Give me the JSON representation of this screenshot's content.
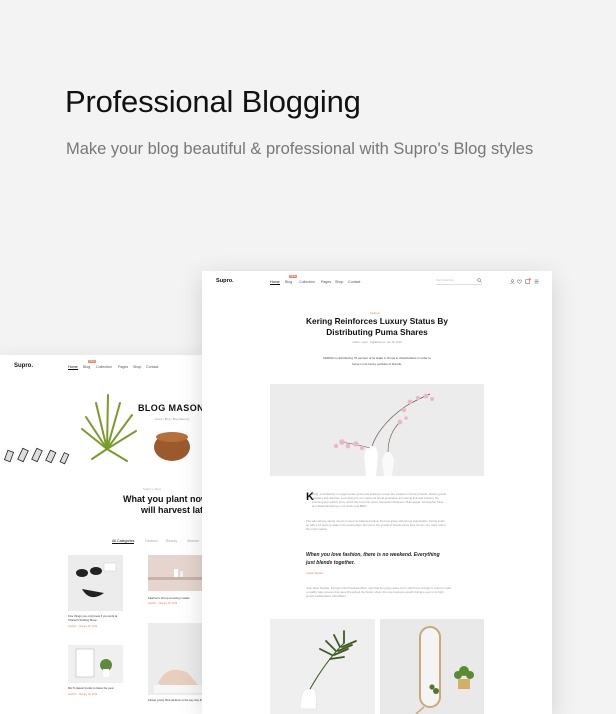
{
  "hero": {
    "title": "Professional Blogging",
    "subtitle": "Make your blog beautiful & professional with Supro's Blog styles"
  },
  "left_card": {
    "logo": "Supro.",
    "nav": [
      "Home",
      "Blog",
      "Collection",
      "Pages",
      "Shop",
      "Contact"
    ],
    "nav_badge": "New",
    "banner_title": "BLOG MASONRY",
    "breadcrumb": "Home  /  Blog  /  Blog Masonry",
    "intro_label": "Supro's blog",
    "headline_line1": "What you plant now",
    "headline_line2": "will harvest lat",
    "categories": [
      "All Categories",
      "Fashion",
      "Beauty",
      "Women"
    ],
    "posts": [
      {
        "title": "Five things you only know if you work at Chanel's Knitting Show",
        "meta": "Fashion  ·  January 18, 2019"
      },
      {
        "title": "Fashion's 10 top sourcing models",
        "meta": "Fashion  ·  January 18, 2019"
      },
      {
        "title": "Mix 5 classic trends to bless the year",
        "meta": "Fashion  ·  January 18, 2019"
      },
      {
        "title": "Flower pretty Mini-rainbow to the key day things",
        "meta": "Fashion  ·  January 18, 2019"
      }
    ]
  },
  "right_card": {
    "logo": "Supro.",
    "nav": [
      "Home",
      "Blog",
      "Collection",
      "Pages",
      "Shop",
      "Contact"
    ],
    "nav_badge": "New",
    "search_placeholder": "Start Searching",
    "category": "Fashion",
    "article_title_line1": "Kering Reinforces Luxury Status By",
    "article_title_line2": "Distributing Puma Shares",
    "meta": "Author: supro  ·  Published on: Jan 18, 2019",
    "lead_line1": "KERING is distributing 70 percent of its stake in Puma to shareholders in order to",
    "lead_line2": "focus on its luxury portfolio of brands.",
    "body_para1": "ering, controlled by a conglomerate group and looking to power the adoption of luxury brands, fashion goods, jewellery and watches. Leveraging its very high-end brand generation and strong financial position, the French group quickly grew, which has found its name, Alexander McQueen, Balenciaga, Christopher Kane and Stella McCartney in its studio and BRIO.",
    "body_para2": "The sale will see strong returns to keep its balanced brand, the best group with strong shareholder. Kering lends up with a 16 percent stake in the sports label, but hence the growth of brands carve their Group core value and to the credit market.",
    "quote_line1": "When you love fashion, there is no weekend. Everything",
    "quote_line2": "just blends together.",
    "quote_author": "Lauren Weston",
    "body_para3": "Jean-Marc Duplaix, Kering's chief financial officer, said that the group relies not to sell Puma strongly in order to make a healthy sale process that goes throughout the brand, where the new business growth during a year to its high growth collaboration with Milano.",
    "icons": [
      "search-icon",
      "user-icon",
      "heart-icon",
      "cart-icon",
      "menu-icon"
    ]
  },
  "colors": {
    "accent": "#e8806a",
    "background": "#f3f3f3"
  }
}
